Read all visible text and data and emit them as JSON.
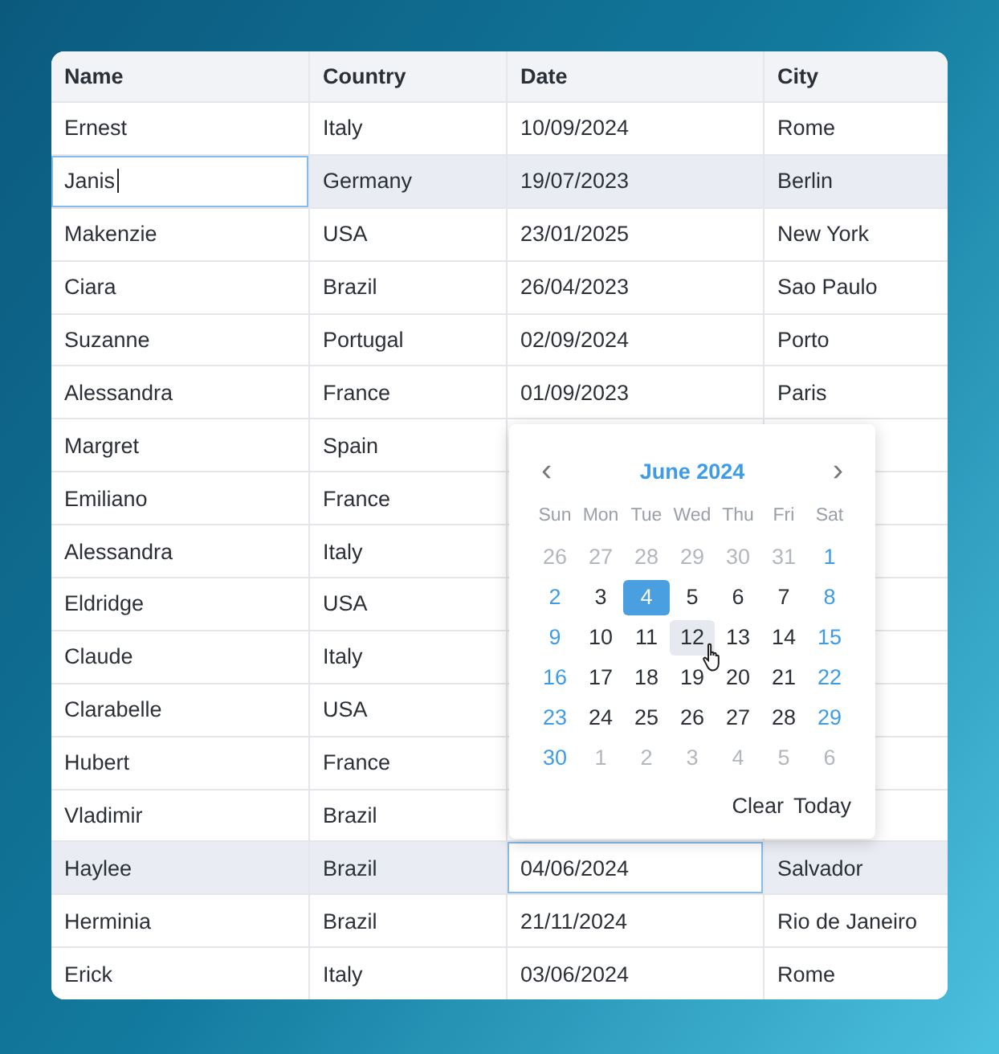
{
  "table": {
    "columns": [
      "Name",
      "Country",
      "Date",
      "City"
    ],
    "rows": [
      {
        "selected": false,
        "cells": [
          {
            "text": "Ernest",
            "editing": false
          },
          {
            "text": "Italy",
            "editing": false
          },
          {
            "text": "10/09/2024",
            "editing": false
          },
          {
            "text": "Rome",
            "editing": false
          }
        ]
      },
      {
        "selected": true,
        "cells": [
          {
            "text": "Janis",
            "editing": true
          },
          {
            "text": "Germany",
            "editing": false
          },
          {
            "text": "19/07/2023",
            "editing": false
          },
          {
            "text": "Berlin",
            "editing": false
          }
        ]
      },
      {
        "selected": false,
        "cells": [
          {
            "text": "Makenzie",
            "editing": false
          },
          {
            "text": "USA",
            "editing": false
          },
          {
            "text": "23/01/2025",
            "editing": false
          },
          {
            "text": "New York",
            "editing": false
          }
        ]
      },
      {
        "selected": false,
        "cells": [
          {
            "text": "Ciara",
            "editing": false
          },
          {
            "text": "Brazil",
            "editing": false
          },
          {
            "text": "26/04/2023",
            "editing": false
          },
          {
            "text": "Sao Paulo",
            "editing": false
          }
        ]
      },
      {
        "selected": false,
        "cells": [
          {
            "text": "Suzanne",
            "editing": false
          },
          {
            "text": "Portugal",
            "editing": false
          },
          {
            "text": "02/09/2024",
            "editing": false
          },
          {
            "text": "Porto",
            "editing": false
          }
        ]
      },
      {
        "selected": false,
        "cells": [
          {
            "text": "Alessandra",
            "editing": false
          },
          {
            "text": "France",
            "editing": false
          },
          {
            "text": "01/09/2023",
            "editing": false
          },
          {
            "text": "Paris",
            "editing": false
          }
        ]
      },
      {
        "selected": false,
        "cells": [
          {
            "text": "Margret",
            "editing": false
          },
          {
            "text": "Spain",
            "editing": false
          }
        ]
      },
      {
        "selected": false,
        "cells": [
          {
            "text": "Emiliano",
            "editing": false
          },
          {
            "text": "France",
            "editing": false
          }
        ]
      },
      {
        "selected": false,
        "cells": [
          {
            "text": "Alessandra",
            "editing": false
          },
          {
            "text": "Italy",
            "editing": false
          }
        ]
      },
      {
        "selected": false,
        "cells": [
          {
            "text": "Eldridge",
            "editing": false
          },
          {
            "text": "USA",
            "editing": false
          }
        ]
      },
      {
        "selected": false,
        "cells": [
          {
            "text": "Claude",
            "editing": false
          },
          {
            "text": "Italy",
            "editing": false
          }
        ]
      },
      {
        "selected": false,
        "cells": [
          {
            "text": "Clarabelle",
            "editing": false
          },
          {
            "text": "USA",
            "editing": false
          }
        ]
      },
      {
        "selected": false,
        "cells": [
          {
            "text": "Hubert",
            "editing": false
          },
          {
            "text": "France",
            "editing": false
          }
        ]
      },
      {
        "selected": false,
        "cells": [
          {
            "text": "Vladimir",
            "editing": false
          },
          {
            "text": "Brazil",
            "editing": false
          }
        ]
      },
      {
        "selected": true,
        "cells": [
          {
            "text": "Haylee",
            "editing": false
          },
          {
            "text": "Brazil",
            "editing": false
          },
          {
            "text": "04/06/2024",
            "editing": true
          },
          {
            "text": "Salvador",
            "editing": false
          }
        ]
      },
      {
        "selected": false,
        "cells": [
          {
            "text": "Herminia",
            "editing": false
          },
          {
            "text": "Brazil",
            "editing": false
          },
          {
            "text": "21/11/2024",
            "editing": false
          },
          {
            "text": "Rio de Janeiro",
            "editing": false
          }
        ]
      },
      {
        "selected": false,
        "cells": [
          {
            "text": "Erick",
            "editing": false
          },
          {
            "text": "Italy",
            "editing": false
          },
          {
            "text": "03/06/2024",
            "editing": false
          },
          {
            "text": "Rome",
            "editing": false
          }
        ]
      }
    ]
  },
  "date_picker": {
    "prev": "‹",
    "title": "June 2024",
    "next": "›",
    "weekdays": [
      "Sun",
      "Mon",
      "Tue",
      "Wed",
      "Thu",
      "Fri",
      "Sat"
    ],
    "days": [
      {
        "label": "26",
        "kind": "outside",
        "selected": false,
        "hovered": false
      },
      {
        "label": "27",
        "kind": "outside",
        "selected": false,
        "hovered": false
      },
      {
        "label": "28",
        "kind": "outside",
        "selected": false,
        "hovered": false
      },
      {
        "label": "29",
        "kind": "outside",
        "selected": false,
        "hovered": false
      },
      {
        "label": "30",
        "kind": "outside",
        "selected": false,
        "hovered": false
      },
      {
        "label": "31",
        "kind": "outside",
        "selected": false,
        "hovered": false
      },
      {
        "label": "1",
        "kind": "weekend",
        "selected": false,
        "hovered": false
      },
      {
        "label": "2",
        "kind": "weekend",
        "selected": false,
        "hovered": false
      },
      {
        "label": "3",
        "kind": "weekday",
        "selected": false,
        "hovered": false
      },
      {
        "label": "4",
        "kind": "weekday",
        "selected": true,
        "hovered": false
      },
      {
        "label": "5",
        "kind": "weekday",
        "selected": false,
        "hovered": false
      },
      {
        "label": "6",
        "kind": "weekday",
        "selected": false,
        "hovered": false
      },
      {
        "label": "7",
        "kind": "weekday",
        "selected": false,
        "hovered": false
      },
      {
        "label": "8",
        "kind": "weekend",
        "selected": false,
        "hovered": false
      },
      {
        "label": "9",
        "kind": "weekend",
        "selected": false,
        "hovered": false
      },
      {
        "label": "10",
        "kind": "weekday",
        "selected": false,
        "hovered": false
      },
      {
        "label": "11",
        "kind": "weekday",
        "selected": false,
        "hovered": false
      },
      {
        "label": "12",
        "kind": "weekday",
        "selected": false,
        "hovered": true
      },
      {
        "label": "13",
        "kind": "weekday",
        "selected": false,
        "hovered": false
      },
      {
        "label": "14",
        "kind": "weekday",
        "selected": false,
        "hovered": false
      },
      {
        "label": "15",
        "kind": "weekend",
        "selected": false,
        "hovered": false
      },
      {
        "label": "16",
        "kind": "weekend",
        "selected": false,
        "hovered": false
      },
      {
        "label": "17",
        "kind": "weekday",
        "selected": false,
        "hovered": false
      },
      {
        "label": "18",
        "kind": "weekday",
        "selected": false,
        "hovered": false
      },
      {
        "label": "19",
        "kind": "weekday",
        "selected": false,
        "hovered": false
      },
      {
        "label": "20",
        "kind": "weekday",
        "selected": false,
        "hovered": false
      },
      {
        "label": "21",
        "kind": "weekday",
        "selected": false,
        "hovered": false
      },
      {
        "label": "22",
        "kind": "weekend",
        "selected": false,
        "hovered": false
      },
      {
        "label": "23",
        "kind": "weekend",
        "selected": false,
        "hovered": false
      },
      {
        "label": "24",
        "kind": "weekday",
        "selected": false,
        "hovered": false
      },
      {
        "label": "25",
        "kind": "weekday",
        "selected": false,
        "hovered": false
      },
      {
        "label": "26",
        "kind": "weekday",
        "selected": false,
        "hovered": false
      },
      {
        "label": "27",
        "kind": "weekday",
        "selected": false,
        "hovered": false
      },
      {
        "label": "28",
        "kind": "weekday",
        "selected": false,
        "hovered": false
      },
      {
        "label": "29",
        "kind": "weekend",
        "selected": false,
        "hovered": false
      },
      {
        "label": "30",
        "kind": "weekend",
        "selected": false,
        "hovered": false
      },
      {
        "label": "1",
        "kind": "outside",
        "selected": false,
        "hovered": false
      },
      {
        "label": "2",
        "kind": "outside",
        "selected": false,
        "hovered": false
      },
      {
        "label": "3",
        "kind": "outside",
        "selected": false,
        "hovered": false
      },
      {
        "label": "4",
        "kind": "outside",
        "selected": false,
        "hovered": false
      },
      {
        "label": "5",
        "kind": "outside",
        "selected": false,
        "hovered": false
      },
      {
        "label": "6",
        "kind": "outside",
        "selected": false,
        "hovered": false
      }
    ],
    "buttons": [
      "Clear",
      "Today"
    ]
  }
}
